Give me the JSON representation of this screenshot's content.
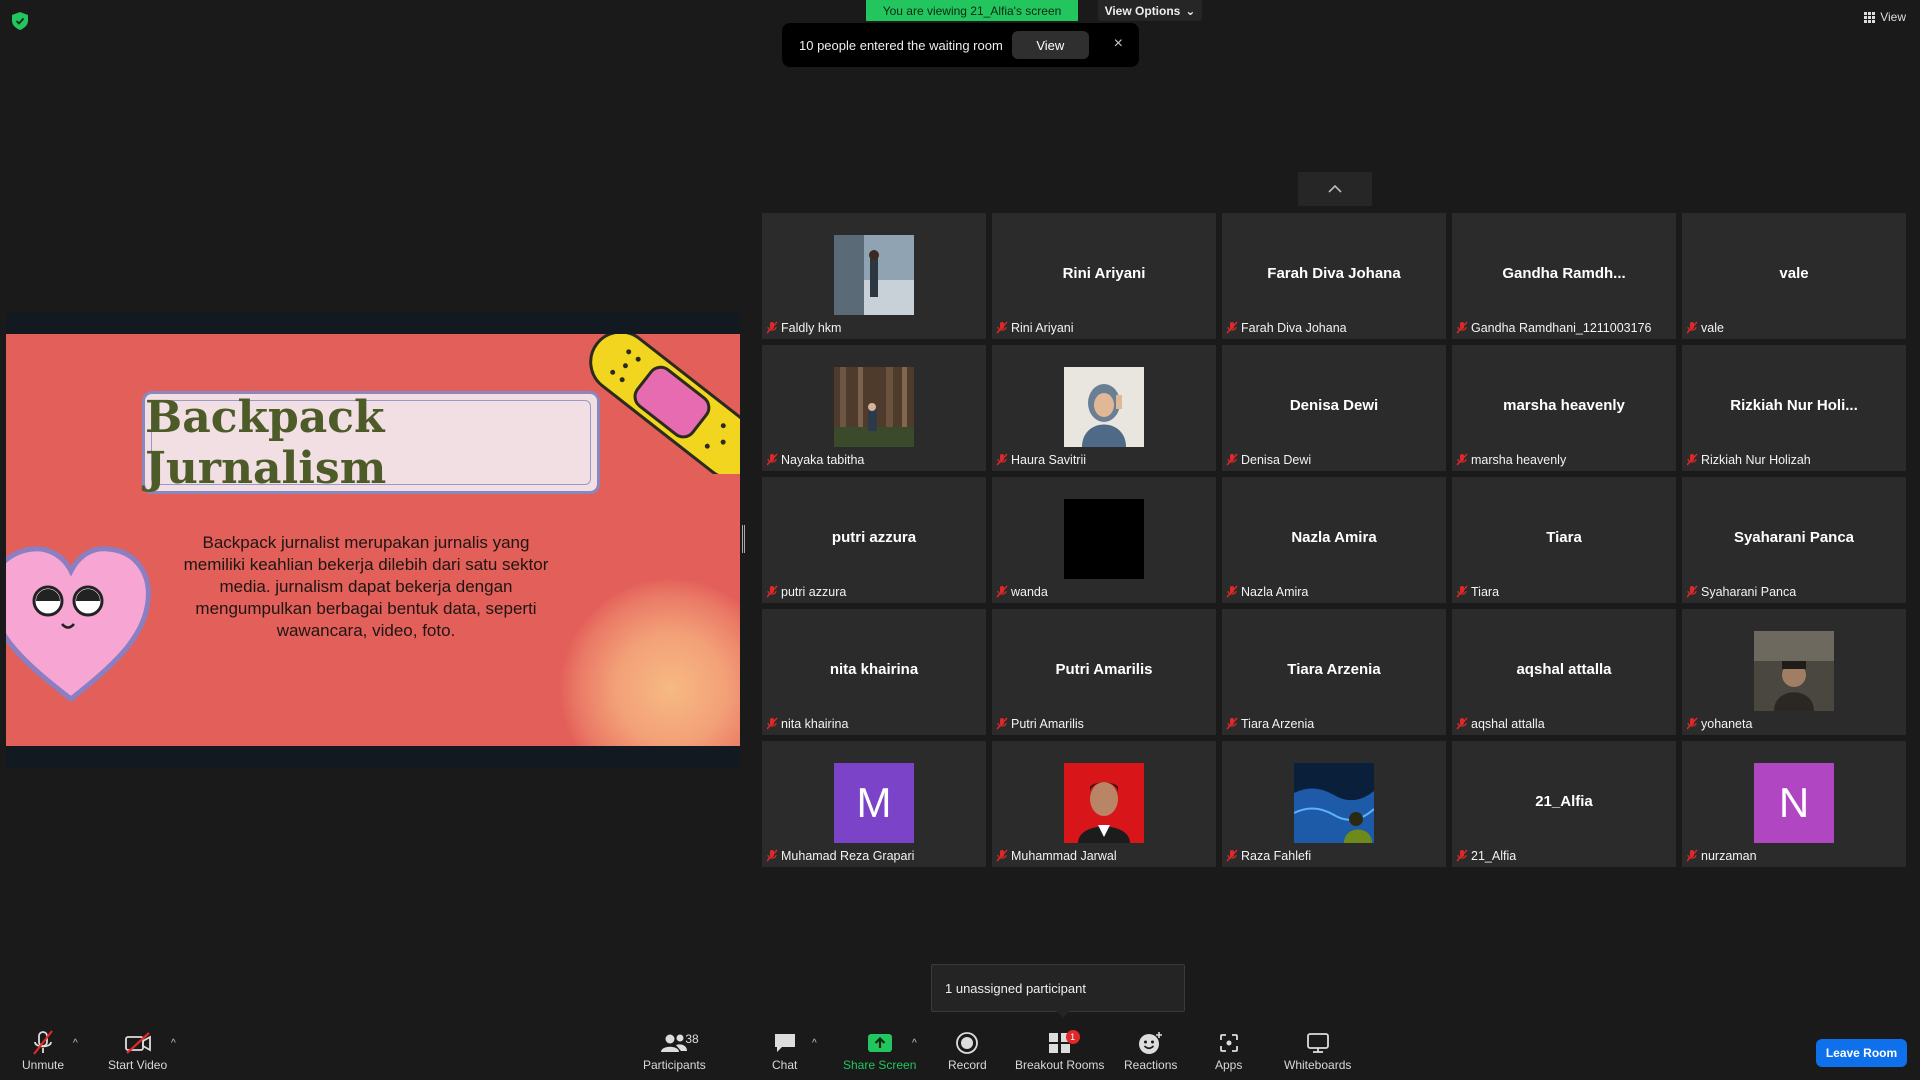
{
  "top": {
    "viewing_banner": "You are viewing 21_Alfia's screen",
    "view_options": "View Options",
    "view": "View"
  },
  "notification": {
    "text": "10 people entered the waiting room",
    "button": "View",
    "close": "×"
  },
  "slide": {
    "title": "Backpack Jurnalism",
    "body": "Backpack jurnalist merupakan jurnalis yang memiliki keahlian bekerja dilebih dari satu sektor media. jurnalism dapat bekerja dengan mengumpulkan berbagai bentuk data, seperti wawancara, video, foto."
  },
  "gallery": {
    "tiles": [
      {
        "name": "Faldly hkm",
        "display": "",
        "media": "photo-outdoor"
      },
      {
        "name": "Rini Ariyani",
        "display": "Rini Ariyani"
      },
      {
        "name": "Farah Diva Johana",
        "display": "Farah Diva Johana"
      },
      {
        "name": "Gandha Ramdhani_1211003176",
        "display": "Gandha  Ramdh..."
      },
      {
        "name": "vale",
        "display": "vale"
      },
      {
        "name": "Nayaka tabitha",
        "display": "",
        "media": "photo-forest"
      },
      {
        "name": "Haura Savitrii",
        "display": "",
        "media": "photo-hijab"
      },
      {
        "name": "Denisa Dewi",
        "display": "Denisa Dewi"
      },
      {
        "name": "marsha heavenly",
        "display": "marsha heavenly"
      },
      {
        "name": "Rizkiah Nur Holizah",
        "display": "Rizkiah  Nur  Holi..."
      },
      {
        "name": "putri azzura",
        "display": "putri azzura"
      },
      {
        "name": "wanda",
        "display": "",
        "media": "black"
      },
      {
        "name": "Nazla Amira",
        "display": "Nazla Amira"
      },
      {
        "name": "Tiara",
        "display": "Tiara"
      },
      {
        "name": "Syaharani Panca",
        "display": "Syaharani Panca"
      },
      {
        "name": "nita khairina",
        "display": "nita khairina"
      },
      {
        "name": "Putri Amarilis",
        "display": "Putri Amarilis"
      },
      {
        "name": "Tiara Arzenia",
        "display": "Tiara Arzenia"
      },
      {
        "name": "aqshal attalla",
        "display": "aqshal attalla"
      },
      {
        "name": "yohaneta",
        "display": "",
        "media": "photo-dark"
      },
      {
        "name": "Muhamad Reza Grapari",
        "display": "",
        "media": "letter",
        "letter": "M",
        "color": "#7a43c8"
      },
      {
        "name": "Muhammad Jarwal",
        "display": "",
        "media": "photo-red"
      },
      {
        "name": "Raza Fahlefi",
        "display": "",
        "media": "photo-blue"
      },
      {
        "name": "21_Alfia",
        "display": "21_Alfia"
      },
      {
        "name": "nurzaman",
        "display": "",
        "media": "letter",
        "letter": "N",
        "color": "#b146c2"
      }
    ]
  },
  "tooltip": "1 unassigned participant",
  "toolbar": {
    "unmute": "Unmute",
    "start_video": "Start Video",
    "participants": "Participants",
    "participants_count": "38",
    "chat": "Chat",
    "share_screen": "Share Screen",
    "record": "Record",
    "breakout_rooms": "Breakout Rooms",
    "breakout_badge": "1",
    "reactions": "Reactions",
    "apps": "Apps",
    "whiteboards": "Whiteboards",
    "leave_room": "Leave Room"
  },
  "colors": {
    "share_green": "#23c55e",
    "leave_blue": "#0e71eb",
    "mute_red": "#e02828",
    "slide_bg": "#e35f59",
    "title_green": "#4d5b28"
  }
}
